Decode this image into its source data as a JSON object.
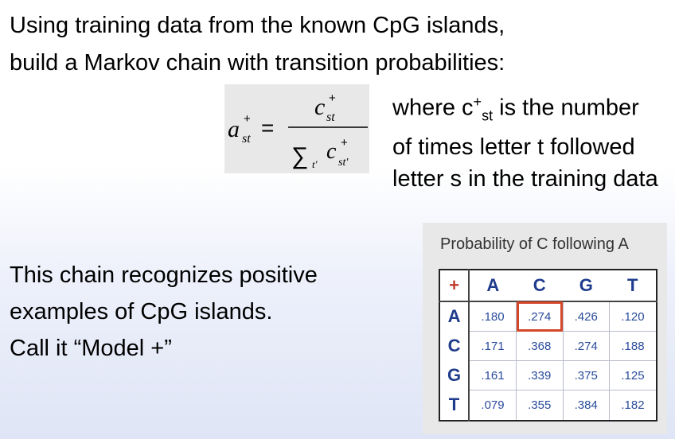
{
  "slide": {
    "intro_line1": "Using training data from the known CpG islands,",
    "intro_line2": "build a Markov chain with transition probabilities:"
  },
  "formula": {
    "lhs_base": "a",
    "lhs_sup": "+",
    "lhs_sub": "st",
    "equals": "=",
    "num_base": "c",
    "num_sup": "+",
    "num_sub": "st",
    "sum_symbol": "∑",
    "sum_sub": "t'",
    "den_base": "c",
    "den_sup": "+",
    "den_sub": "st'"
  },
  "explanation": {
    "l1_pre": "where c",
    "l1_sup": "+",
    "l1_sub": "st",
    "l1_post": " is the number",
    "l2": "of times letter t followed",
    "l3": "letter s in the training data"
  },
  "left_text": {
    "line1": "This chain recognizes positive",
    "line2": "examples of CpG islands.",
    "line3": "Call it “Model +”"
  },
  "prob_table": {
    "title": "Probability of C following A",
    "corner": "+",
    "col_headers": [
      "A",
      "C",
      "G",
      "T"
    ],
    "rows": [
      {
        "label": "A",
        "values": [
          ".180",
          ".274",
          ".426",
          ".120"
        ]
      },
      {
        "label": "C",
        "values": [
          ".171",
          ".368",
          ".274",
          ".188"
        ]
      },
      {
        "label": "G",
        "values": [
          ".161",
          ".339",
          ".375",
          ".125"
        ]
      },
      {
        "label": "T",
        "values": [
          ".079",
          ".355",
          ".384",
          ".182"
        ]
      }
    ],
    "highlighted_cell": {
      "row": "A",
      "col": "C"
    },
    "highlight_color": "#d4472a"
  }
}
